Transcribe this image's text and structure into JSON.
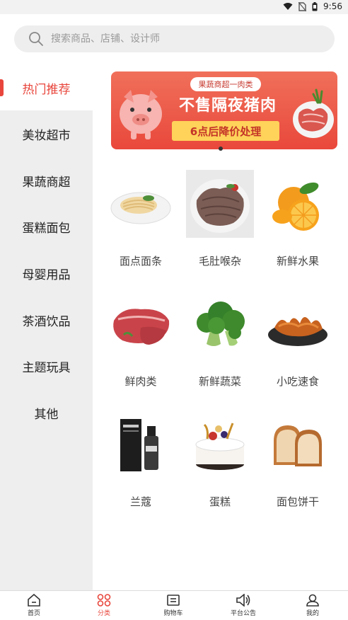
{
  "status": {
    "time": "9:56"
  },
  "search": {
    "placeholder": "搜索商品、店铺、设计师"
  },
  "sidebar": {
    "items": [
      {
        "label": "热门推荐",
        "active": true
      },
      {
        "label": "美妆超市"
      },
      {
        "label": "果蔬商超"
      },
      {
        "label": "蛋糕面包"
      },
      {
        "label": "母婴用品"
      },
      {
        "label": "茶酒饮品"
      },
      {
        "label": "主题玩具"
      },
      {
        "label": "其他"
      }
    ]
  },
  "banner": {
    "tag": "果蔬商超一肉类",
    "headline": "不售隔夜猪肉",
    "subline": "6点后降价处理"
  },
  "products": [
    {
      "label": "面点面条",
      "icon": "noodles-icon"
    },
    {
      "label": "毛肚喉杂",
      "icon": "tripe-icon"
    },
    {
      "label": "新鲜水果",
      "icon": "orange-icon"
    },
    {
      "label": "鲜肉类",
      "icon": "meat-icon"
    },
    {
      "label": "新鲜蔬菜",
      "icon": "broccoli-icon"
    },
    {
      "label": "小吃速食",
      "icon": "chicken-feet-icon"
    },
    {
      "label": "兰蔻",
      "icon": "cosmetics-icon"
    },
    {
      "label": "蛋糕",
      "icon": "cake-icon"
    },
    {
      "label": "面包饼干",
      "icon": "bread-icon"
    }
  ],
  "tabbar": {
    "items": [
      {
        "label": "首页",
        "icon": "home-icon"
      },
      {
        "label": "分类",
        "icon": "category-icon",
        "active": true
      },
      {
        "label": "购物车",
        "icon": "cart-icon"
      },
      {
        "label": "平台公告",
        "icon": "speaker-icon"
      },
      {
        "label": "我的",
        "icon": "user-icon"
      }
    ]
  },
  "colors": {
    "accent": "#e8463c",
    "sidebar_bg": "#eeeeee"
  }
}
